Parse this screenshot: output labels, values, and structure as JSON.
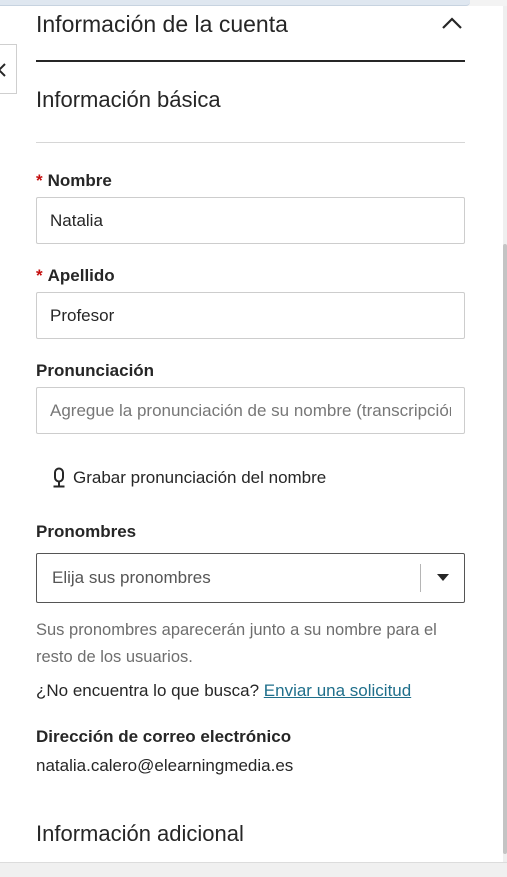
{
  "account_section": {
    "title": "Información de la cuenta",
    "collapse_icon": "chevron-up-icon"
  },
  "basic_info": {
    "heading": "Información básica"
  },
  "fields": {
    "first_name": {
      "label": "Nombre",
      "required_mark": "*",
      "value": "Natalia"
    },
    "last_name": {
      "label": "Apellido",
      "required_mark": "*",
      "value": "Profesor"
    },
    "pronunciation": {
      "label": "Pronunciación",
      "placeholder": "Agregue la pronunciación de su nombre (transcripción fonética)",
      "value": ""
    },
    "record_link": {
      "label": "Grabar pronunciación del nombre",
      "icon": "microphone-icon"
    },
    "pronouns": {
      "label": "Pronombres",
      "placeholder": "Elija sus pronombres",
      "dropdown_icon": "caret-down-icon",
      "help_text": "Sus pronombres aparecerán junto a su nombre para el resto de los usuarios.",
      "not_found_text": "¿No encuentra lo que busca?",
      "request_link": "Enviar una solicitud"
    },
    "email": {
      "label": "Dirección de correo electrónico",
      "value": "natalia.calero@elearningmedia.es"
    }
  },
  "additional_info": {
    "heading": "Información adicional"
  },
  "colors": {
    "text": "#262626",
    "required": "#c40d0d",
    "link": "#1f6f8b",
    "muted": "#6e6e6e"
  }
}
